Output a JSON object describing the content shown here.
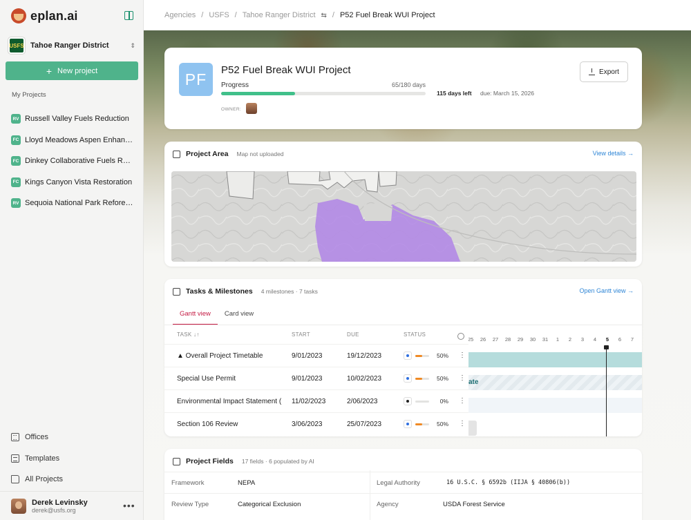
{
  "brand": {
    "name": "eplan.ai"
  },
  "org": {
    "badge": "USFS",
    "name": "Tahoe Ranger District"
  },
  "sidebar": {
    "new_project": "New project",
    "my_projects_title": "My Projects",
    "projects": [
      {
        "tag": "RV",
        "title": "Russell Valley Fuels Reduction"
      },
      {
        "tag": "FC",
        "title": "Lloyd Meadows Aspen Enhance..."
      },
      {
        "tag": "FC",
        "title": "Dinkey Collaborative Fuels Redu..."
      },
      {
        "tag": "FC",
        "title": "Kings Canyon Vista Restoration"
      },
      {
        "tag": "RV",
        "title": "Sequoia National Park Reforesta..."
      }
    ],
    "nav": [
      {
        "label": "Offices",
        "icon": "building-icon"
      },
      {
        "label": "Templates",
        "icon": "document-icon"
      },
      {
        "label": "All Projects",
        "icon": "folder-icon"
      }
    ],
    "user": {
      "name": "Derek Levinsky",
      "email": "derek@usfs.org"
    }
  },
  "breadcrumb": {
    "agencies": "Agencies",
    "usfs": "USFS",
    "district": "Tahoe Ranger District",
    "current": "P52 Fuel Break WUI Project",
    "sep": "/"
  },
  "project": {
    "initials": "PF",
    "title": "P52 Fuel Break WUI Project",
    "progress_label": "Progress",
    "progress_days": "65/180 days",
    "progress_fraction": 0.361,
    "days_left": "115 days left",
    "due": "due: March 15, 2026",
    "owner_label": "OWNER:",
    "export_label": "Export"
  },
  "area": {
    "title": "Project Area",
    "status": "Map not uploaded",
    "link": "View details →"
  },
  "tasks": {
    "title": "Tasks & Milestones",
    "summary": "4 milestones · 7 tasks",
    "link": "Open Gantt view →",
    "tabs": [
      "Gantt view",
      "Card view"
    ],
    "headers": {
      "task": "TASK ↓↑",
      "start": "START",
      "due": "DUE",
      "status": "STATUS"
    },
    "rows": [
      {
        "task": "▲ Overall Project Timetable",
        "start": "9/01/2023",
        "due": "19/12/2023",
        "dot": "#2f6fe0",
        "bar": "#f08a24",
        "pct": "50%",
        "fill": 0.5
      },
      {
        "task": "Special Use Permit",
        "start": "9/01/2023",
        "due": "10/02/2023",
        "dot": "#2f6fe0",
        "bar": "#f08a24",
        "pct": "50%",
        "fill": 0.5
      },
      {
        "task": "Environmental Impact Statement (",
        "start": "11/02/2023",
        "due": "2/06/2023",
        "dot": "#222222",
        "bar": "#e3e3e1",
        "pct": "0%",
        "fill": 0
      },
      {
        "task": "Section 106 Review",
        "start": "3/06/2023",
        "due": "25/07/2023",
        "dot": "#2f6fe0",
        "bar": "#f08a24",
        "pct": "50%",
        "fill": 0.5
      }
    ],
    "gantt_days": [
      "25",
      "26",
      "27",
      "28",
      "29",
      "30",
      "31",
      "1",
      "2",
      "3",
      "4",
      "5",
      "6",
      "7"
    ],
    "gantt_today": "5",
    "gantt_label": "ate"
  },
  "fields": {
    "title": "Project Fields",
    "summary": "17 fields · 6 populated by AI",
    "rows": [
      {
        "l1": "Framework",
        "v1": "NEPA",
        "l2": "Legal Authority",
        "v2": "16 U.S.C. § 6592b (IIJA § 40806(b))"
      },
      {
        "l1": "Review Type",
        "v1": "Categorical Exclusion",
        "l2": "Agency",
        "v2": "USDA Forest Service"
      }
    ]
  },
  "colors": {
    "accent": "#4fb38b",
    "progress": "#40c08a",
    "tab_active": "#c41a43",
    "link": "#2f86d6",
    "avatar_bg": "#8fc3f0",
    "polygon": "#b38ae6"
  }
}
